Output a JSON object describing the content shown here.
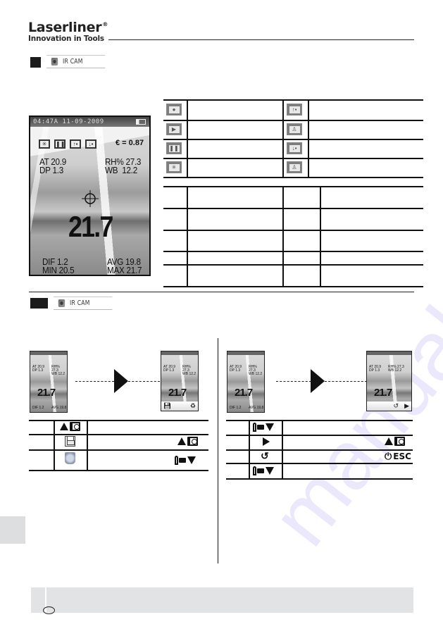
{
  "header": {
    "brand": "Laserliner",
    "registered_mark": "®",
    "tagline": "Innovation in Tools"
  },
  "section_top": {
    "mode_label": "IR CAM",
    "mode_icon": "ir-camera-icon",
    "device_screen": {
      "time_date": "04:47A 11-09-2009",
      "battery_icon": "battery-icon",
      "toolbar_icons": [
        "laser-icon",
        "pause-icon",
        "alarm-high-icon",
        "alarm-low-icon"
      ],
      "emissivity": "€ = 0.87",
      "at": "AT 20.9",
      "rh": "RH% 27.3",
      "dp": "DP 1.3",
      "wb": "WB  12.2",
      "main_reading": "21.7",
      "dif": "DIF 1.2",
      "avg": "AVG 19.8",
      "min": "MIN 20.5",
      "max": "MAX 21.7"
    },
    "icon_table": {
      "left_icons": [
        "camera-icon",
        "play-icon",
        "pause-icon",
        "laser-icon"
      ],
      "right_icons": [
        "alarm-high-icon",
        "dewpoint-alarm-icon",
        "alarm-low-icon",
        "dewpoint-alarm-off-icon"
      ]
    },
    "blank_table_rows": 5
  },
  "section_bottom": {
    "mode_label": "IR CAM",
    "mode_icon": "ir-camera-icon",
    "left_panel": {
      "mini_screen_main": "21.7",
      "mini_screen_footer_icons": [
        "save-icon",
        "delete-icon"
      ],
      "rows": [
        {
          "icon": "up-camera-key",
          "key_right": null
        },
        {
          "icon": "save-icon",
          "key_right": "up-camera-key"
        },
        {
          "icon": "delete-icon",
          "key_right": "torch-down-key"
        }
      ]
    },
    "right_panel": {
      "mini_screen_main": "21.7",
      "mini_screen_footer_icons": [
        "rotate-icon",
        "play-icon"
      ],
      "rows": [
        {
          "icon": "torch-down-key",
          "key_right": null
        },
        {
          "icon": "play-icon",
          "key_right": "up-camera-key"
        },
        {
          "icon": "rotate-icon",
          "key_right": "power-esc-key",
          "key_right_label": "ESC"
        },
        {
          "icon": "torch-down-key",
          "key_right": null
        }
      ]
    }
  },
  "watermark": {
    "text": "manualsarchive.com",
    "color": "#c8c4f0"
  },
  "colors": {
    "section_box": "#1c1c1c",
    "footer_bar": "#e2e3e4",
    "side_tab": "#dcdedf",
    "icon_gray": "#7d7d7d"
  }
}
